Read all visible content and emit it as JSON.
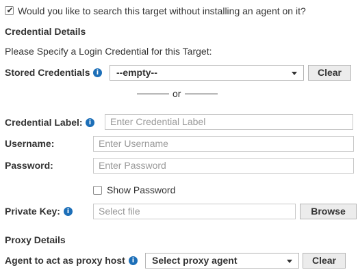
{
  "agentless": {
    "checked": true,
    "label": "Would you like to search this target without installing an agent on it?"
  },
  "credential_details": {
    "heading": "Credential Details",
    "instruction": "Please Specify a Login Credential for this Target:",
    "stored_credentials_label": "Stored Credentials",
    "stored_credentials_value": "--empty--",
    "clear_label": "Clear",
    "or_text": "or",
    "credential_label_label": "Credential Label:",
    "credential_label_placeholder": "Enter Credential Label",
    "username_label": "Username:",
    "username_placeholder": "Enter Username",
    "password_label": "Password:",
    "password_placeholder": "Enter Password",
    "show_password_label": "Show Password",
    "show_password_checked": false,
    "private_key_label": "Private Key:",
    "private_key_placeholder": "Select file",
    "browse_label": "Browse"
  },
  "proxy_details": {
    "heading": "Proxy Details",
    "agent_label": "Agent to act as proxy host",
    "agent_select_value": "Select proxy agent",
    "clear_label": "Clear"
  },
  "icons": {
    "info": "info-icon",
    "dropdown": "chevron-down-icon",
    "checkbox": "checkbox-icon"
  },
  "colors": {
    "info_icon": "#1d6fb8",
    "button_bg": "#ececec",
    "text": "#333333",
    "placeholder": "#999999"
  }
}
